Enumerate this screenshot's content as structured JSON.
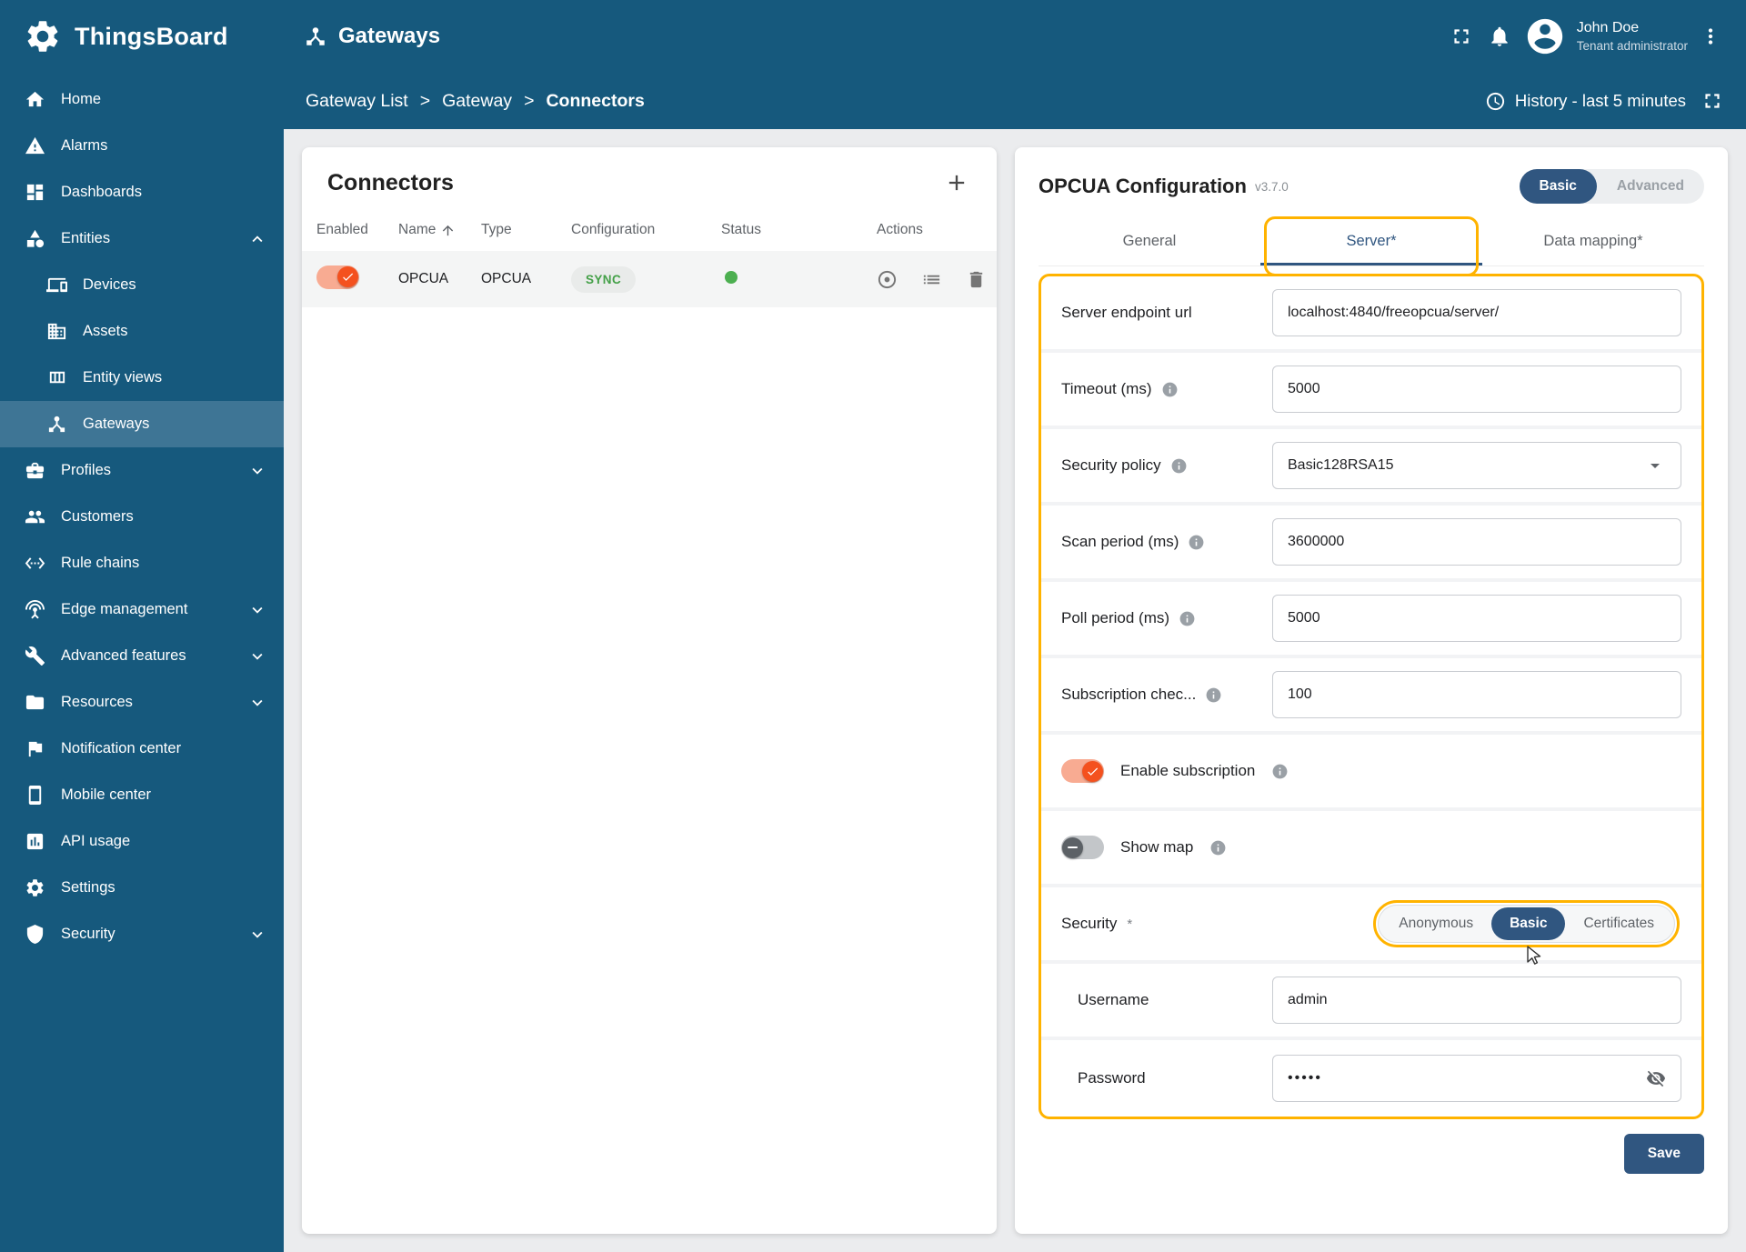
{
  "colors": {
    "header_bg": "#16597d",
    "primary": "#305680",
    "highlight_outline": "#ffb300",
    "toggle_on": "#f4511e",
    "status_green": "#4caf50"
  },
  "app": {
    "brand": "ThingsBoard",
    "page_title": "Gateways",
    "user": {
      "name": "John Doe",
      "role": "Tenant administrator"
    },
    "breadcrumb": [
      "Gateway List",
      "Gateway",
      "Connectors"
    ],
    "breadcrumb_separator": ">",
    "history_label": "History - last 5 minutes"
  },
  "sidebar": {
    "items": [
      {
        "label": "Home",
        "icon": "home"
      },
      {
        "label": "Alarms",
        "icon": "warning"
      },
      {
        "label": "Dashboards",
        "icon": "dashboard"
      },
      {
        "label": "Entities",
        "icon": "category",
        "expandable": true,
        "expanded": true
      },
      {
        "label": "Devices",
        "icon": "devices",
        "child": true
      },
      {
        "label": "Assets",
        "icon": "domain",
        "child": true
      },
      {
        "label": "Entity views",
        "icon": "view-column",
        "child": true
      },
      {
        "label": "Gateways",
        "icon": "device-hub",
        "child": true,
        "active": true
      },
      {
        "label": "Profiles",
        "icon": "business-center",
        "expandable": true
      },
      {
        "label": "Customers",
        "icon": "people"
      },
      {
        "label": "Rule chains",
        "icon": "settings-ethernet"
      },
      {
        "label": "Edge management",
        "icon": "antenna",
        "expandable": true
      },
      {
        "label": "Advanced features",
        "icon": "tools",
        "expandable": true
      },
      {
        "label": "Resources",
        "icon": "folder",
        "expandable": true
      },
      {
        "label": "Notification center",
        "icon": "flag"
      },
      {
        "label": "Mobile center",
        "icon": "smartphone"
      },
      {
        "label": "API usage",
        "icon": "insert-chart"
      },
      {
        "label": "Settings",
        "icon": "gear"
      },
      {
        "label": "Security",
        "icon": "security",
        "expandable": true
      }
    ]
  },
  "connectors": {
    "title": "Connectors",
    "columns": [
      "Enabled",
      "Name",
      "Type",
      "Configuration",
      "Status",
      "Actions"
    ],
    "rows": [
      {
        "enabled": true,
        "name": "OPCUA",
        "type": "OPCUA",
        "configuration": "SYNC",
        "status_online": true
      }
    ]
  },
  "config": {
    "title": "OPCUA Configuration",
    "version": "v3.7.0",
    "mode_toggle": {
      "options": [
        "Basic",
        "Advanced"
      ],
      "selected": "Basic"
    },
    "tabs": [
      {
        "label": "General",
        "active": false
      },
      {
        "label": "Server*",
        "active": true
      },
      {
        "label": "Data mapping*",
        "active": false
      }
    ],
    "fields": [
      {
        "label": "Server endpoint url",
        "value": "localhost:4840/freeopcua/server/",
        "info": false,
        "type": "text"
      },
      {
        "label": "Timeout (ms)",
        "value": "5000",
        "info": true,
        "type": "text"
      },
      {
        "label": "Security policy",
        "value": "Basic128RSA15",
        "info": true,
        "type": "select"
      },
      {
        "label": "Scan period (ms)",
        "value": "3600000",
        "info": true,
        "type": "text"
      },
      {
        "label": "Poll period (ms)",
        "value": "5000",
        "info": true,
        "type": "text"
      },
      {
        "label": "Subscription chec...",
        "value": "100",
        "info": true,
        "type": "text"
      }
    ],
    "toggles": [
      {
        "label": "Enable subscription",
        "on": true
      },
      {
        "label": "Show map",
        "on": false
      }
    ],
    "security": {
      "label": "Security",
      "required_marker": "*",
      "options": [
        "Anonymous",
        "Basic",
        "Certificates"
      ],
      "selected": "Basic",
      "username_label": "Username",
      "username_value": "admin",
      "password_label": "Password",
      "password_mask": "•••••"
    },
    "save_label": "Save"
  }
}
